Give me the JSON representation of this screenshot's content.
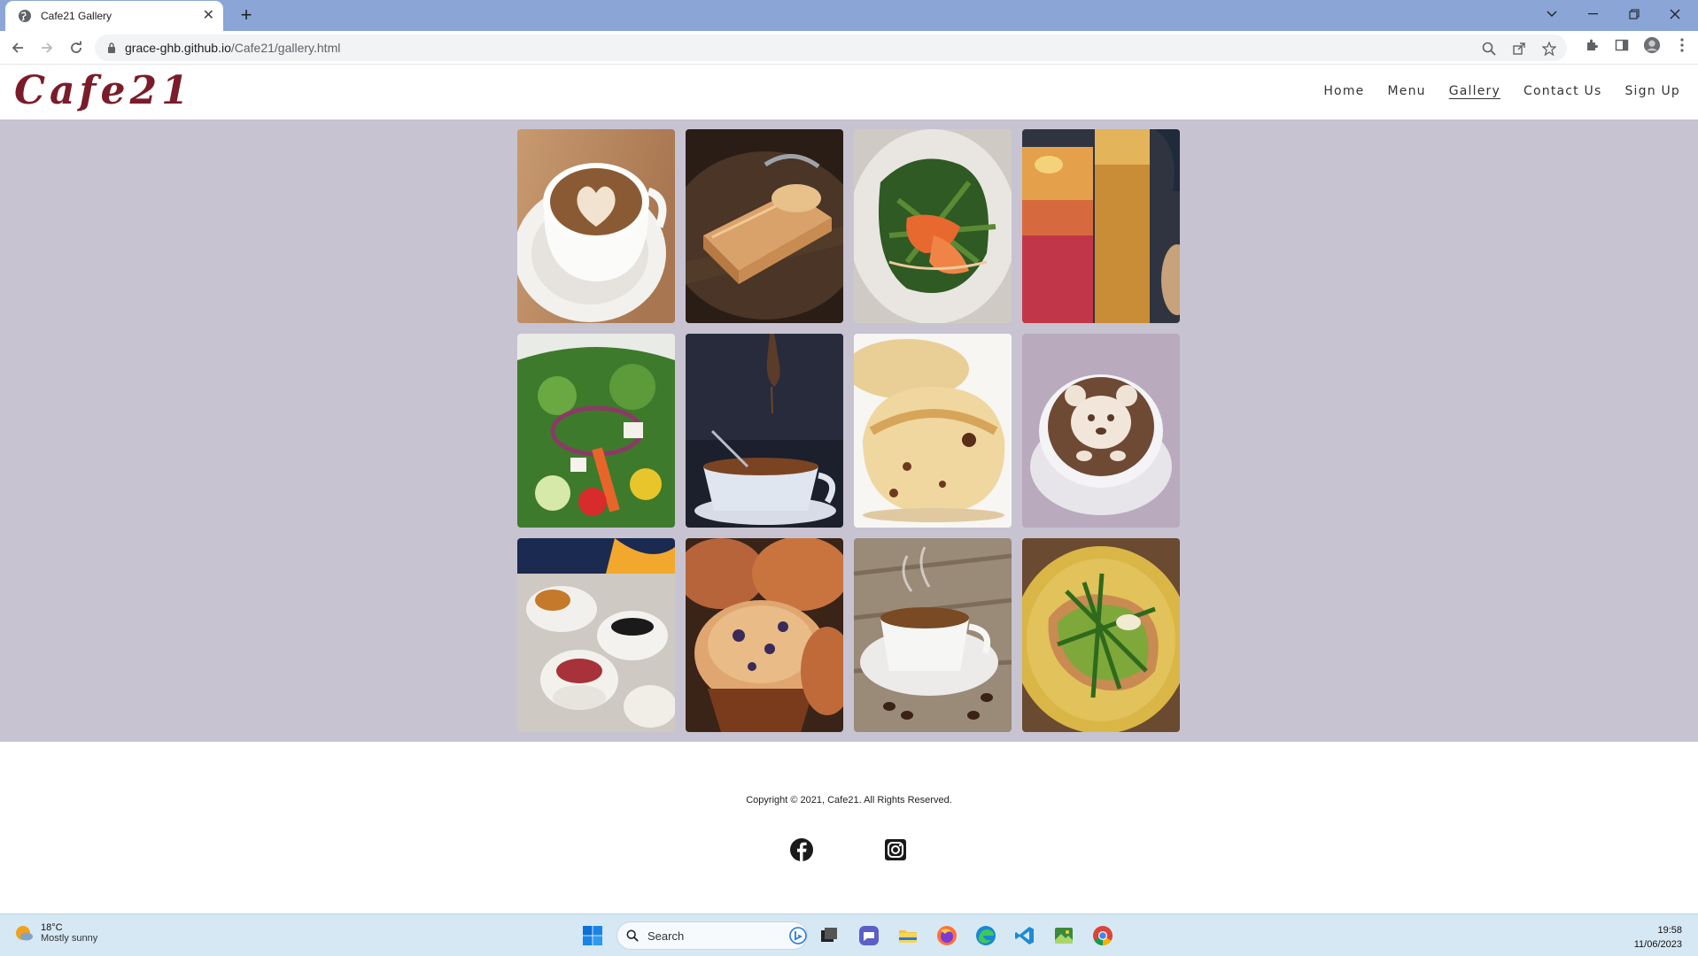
{
  "browser": {
    "tab_title": "Cafe21 Gallery",
    "url_host": "grace-ghb.github.io",
    "url_path": "/Cafe21/gallery.html"
  },
  "site": {
    "logo": "Cafe21",
    "nav": [
      {
        "label": "Home"
      },
      {
        "label": "Menu"
      },
      {
        "label": "Gallery",
        "active": true
      },
      {
        "label": "Contact Us"
      },
      {
        "label": "Sign Up"
      }
    ]
  },
  "gallery": {
    "images": [
      {
        "subject": "latte-art-heart"
      },
      {
        "subject": "cheesecake-slice"
      },
      {
        "subject": "salad-with-salmon"
      },
      {
        "subject": "iced-drinks"
      },
      {
        "subject": "garden-salad"
      },
      {
        "subject": "tea-bag-cup"
      },
      {
        "subject": "scones"
      },
      {
        "subject": "bear-latte-art"
      },
      {
        "subject": "sushi-rolls"
      },
      {
        "subject": "blueberry-muffins"
      },
      {
        "subject": "espresso-cup-beans"
      },
      {
        "subject": "avocado-toast"
      }
    ]
  },
  "footer": {
    "copyright": "Copyright © 2021, Cafe21. All Rights Reserved.",
    "social": [
      "facebook-icon",
      "instagram-icon"
    ]
  },
  "taskbar": {
    "temperature": "18°C",
    "condition": "Mostly sunny",
    "search_label": "Search",
    "time": "19:58",
    "date": "11/06/2023"
  }
}
